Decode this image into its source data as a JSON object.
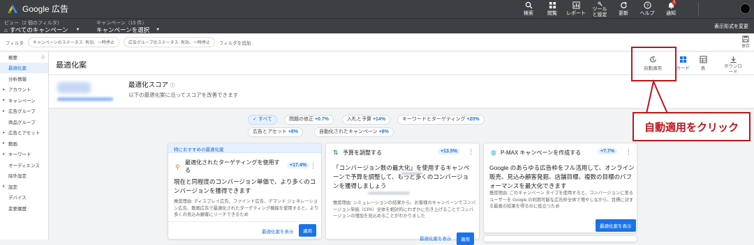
{
  "app": {
    "name": "Google 広告"
  },
  "topbar": {
    "items": [
      {
        "label": "検索",
        "icon": "search-icon"
      },
      {
        "label": "閲覧",
        "icon": "grid-icon"
      },
      {
        "label": "レポート",
        "icon": "report-icon"
      },
      {
        "label": "ツール\nと設定",
        "icon": "wrench-icon"
      },
      {
        "label": "更新",
        "icon": "refresh-icon"
      },
      {
        "label": "ヘルプ",
        "icon": "help-icon"
      },
      {
        "label": "通知",
        "icon": "bell-icon"
      }
    ],
    "notification_count": "1"
  },
  "subbar": {
    "view_label": "ビュー（2 個のフィルタ）",
    "view_value": "すべてのキャンペーン",
    "campaign_label": "キャンペーン（15 件）",
    "campaign_value": "キャンペーンを選択",
    "display_format": "表示形式を変更"
  },
  "filters": {
    "label": "フィルタ",
    "chips": [
      "キャンペーンのステータス: 有効、一時停止",
      "広告グループのステータス: 有効、一時停止"
    ],
    "add": "フィルタを追加",
    "save": "保存"
  },
  "sidebar": {
    "items": [
      {
        "label": "概要",
        "caret": false,
        "active": false
      },
      {
        "label": "最適化案",
        "caret": false,
        "active": true
      },
      {
        "label": "分析情報",
        "caret": false,
        "active": false
      },
      {
        "label": "アカウント",
        "caret": true,
        "active": false
      },
      {
        "label": "キャンペーン",
        "caret": true,
        "active": false
      },
      {
        "label": "広告グループ",
        "caret": true,
        "active": false
      },
      {
        "label": "商品グループ",
        "caret": false,
        "active": false
      },
      {
        "label": "広告とアセット",
        "caret": true,
        "active": false
      },
      {
        "label": "動画",
        "caret": true,
        "active": false
      },
      {
        "label": "キーワード",
        "caret": true,
        "active": false
      },
      {
        "label": "オーディエンス",
        "caret": false,
        "active": false
      },
      {
        "label": "除外設定",
        "caret": false,
        "active": false
      },
      {
        "label": "設定",
        "caret": true,
        "active": false
      },
      {
        "label": "デバイス",
        "caret": false,
        "active": false
      },
      {
        "label": "変更履歴",
        "caret": false,
        "active": false
      }
    ]
  },
  "header": {
    "title": "最適化案",
    "auto_apply": "自動適用",
    "card": "カード",
    "table": "表",
    "download": "ダウンロード"
  },
  "score": {
    "title": "最適化スコア",
    "desc": "以下の最適化案に沿ってスコアを改善できます"
  },
  "filter_chips": [
    {
      "label": "すべて",
      "delta": "",
      "selected": true
    },
    {
      "label": "問題の修正",
      "delta": "+0.7%",
      "selected": false
    },
    {
      "label": "入札と予算",
      "delta": "+14%",
      "selected": false
    },
    {
      "label": "キーワードとターゲティング",
      "delta": "+20%",
      "selected": false
    },
    {
      "label": "広告とアセット",
      "delta": "+8%",
      "selected": false
    },
    {
      "label": "自動化されたキャンペーン",
      "delta": "+8%",
      "selected": false
    }
  ],
  "cards": [
    {
      "header": "特におすすめの最適化案",
      "title": "最適化されたターゲティングを使用する",
      "delta": "+17.4%",
      "body": "現在と同程度のコンバージョン単価で、より多くのコンバージョンを獲得できます",
      "reason": "推奨理由: ディスプレイ広告、ファインド広告、デマンド ジェネレーション広告、動画広告で最適化されたターゲティング機能を使用すると、より多くの見込み顧客にリーチできるため",
      "link": "最適化案を表示",
      "button": "適用"
    },
    {
      "title": "予算を調整する",
      "delta": "+13.5%",
      "body": "「コンバージョン数の最大化」を使用するキャンペーンで予算を調整して、もっと多くのコンバージョンを獲得しましょう",
      "reason": "推奨理由: シミュレーションの結果から、お客様のキャンペーンでコンバージョン単価（CPA）全体を相対的にわずかに引き上げることでコンバージョンの増加を見込めることがわかりました",
      "link": "最適化案を表示",
      "button": "適用"
    },
    {
      "title": "P-MAX キャンペーンを作成する",
      "delta": "+7.7%",
      "body": "Google のあらゆる広告枠をフル活用して、オンライン販売、見込み顧客発掘、店舗目標、複数の目標のパフォーマンスを最大化できます",
      "reason": "推奨理由: このキャンペーン タイプを使用すると、コンバージョンに至るユーザーを Google の利用可能な広告枠全体で増やしながら、目標に対する最善の結果を得るのに役立つため",
      "button": "最適化案を表示"
    }
  ],
  "annotation": {
    "callout": "自動適用をクリック"
  },
  "colors": {
    "accent": "#1a73e8",
    "callout": "#c0121c",
    "topbar": "#3c4043"
  }
}
